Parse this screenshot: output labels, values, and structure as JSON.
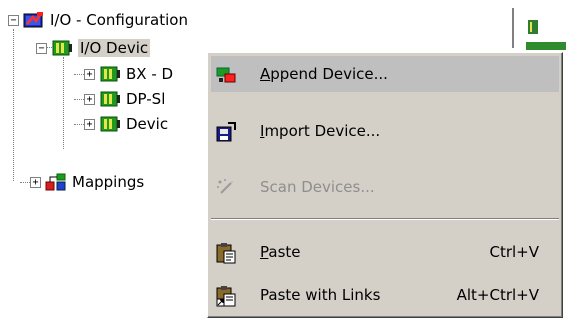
{
  "tree": {
    "root": {
      "label": "I/O - Configuration",
      "expander": "−",
      "icon": "io-config-icon"
    },
    "io_devices": {
      "label": "I/O Devices",
      "visible_label": "I/O Devic",
      "expander": "−",
      "icon": "device-card-icon"
    },
    "children": [
      {
        "label": "BX - D",
        "expander": "+",
        "icon": "device-card-icon"
      },
      {
        "label": "DP-Sl",
        "expander": "+",
        "icon": "device-card-icon"
      },
      {
        "label": "Devic",
        "expander": "+",
        "icon": "device-card-icon"
      }
    ],
    "mappings": {
      "label": "Mappings",
      "expander": "+",
      "icon": "mappings-icon"
    }
  },
  "menu": {
    "items": [
      {
        "pre": "",
        "mnemonic": "A",
        "post": "ppend Device...",
        "shortcut": "",
        "enabled": true,
        "highlighted": true,
        "icon": "append-device-icon"
      },
      {
        "pre": "",
        "mnemonic": "I",
        "post": "mport Device...",
        "shortcut": "",
        "enabled": true,
        "highlighted": false,
        "icon": "import-device-icon"
      },
      {
        "pre": "",
        "mnemonic": "",
        "post": "Scan Devices...",
        "shortcut": "",
        "enabled": false,
        "highlighted": false,
        "icon": "scan-devices-icon"
      },
      {
        "pre": "",
        "mnemonic": "P",
        "post": "aste",
        "shortcut": "Ctrl+V",
        "enabled": true,
        "highlighted": false,
        "icon": "paste-icon"
      },
      {
        "pre": "Paste with Links",
        "mnemonic": "",
        "post": "",
        "shortcut": "Alt+Ctrl+V",
        "enabled": true,
        "highlighted": false,
        "icon": "paste-links-icon"
      }
    ]
  },
  "colors": {
    "menu_bg": "#d4d0c8",
    "highlight": "#bfbfbf",
    "disabled_text": "#8e8e8e",
    "card_green": "#1f9a1f"
  }
}
